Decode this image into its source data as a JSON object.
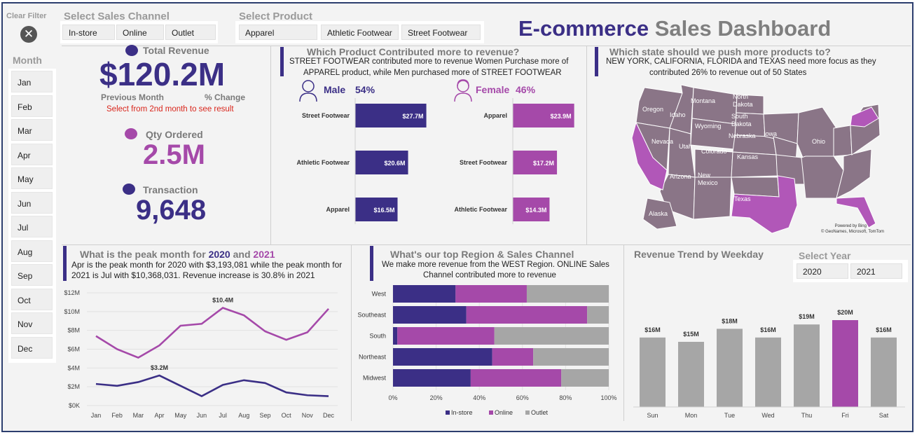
{
  "clear_filter": {
    "label": "Clear Filter"
  },
  "month_slicer": {
    "title": "Month",
    "months": [
      "Jan",
      "Feb",
      "Mar",
      "Apr",
      "May",
      "Jun",
      "Jul",
      "Aug",
      "Sep",
      "Oct",
      "Nov",
      "Dec"
    ]
  },
  "channel_slicer": {
    "title": "Select Sales Channel",
    "options": [
      "In-store",
      "Online",
      "Outlet"
    ]
  },
  "product_slicer": {
    "title": "Select Product",
    "options": [
      "Apparel",
      "Athletic Footwear",
      "Street Footwear"
    ]
  },
  "dashboard_title": {
    "part1": "E-commerce",
    "part2": "Sales Dashboard"
  },
  "kpis": {
    "revenue_label": "Total Revenue",
    "revenue_value": "$120.2M",
    "prev_month_label": "Previous Month",
    "pct_change_label": "% Change",
    "note": "Select from 2nd month to see result",
    "qty_label": "Qty Ordered",
    "qty_value": "2.5M",
    "txn_label": "Transaction",
    "txn_value": "9,648"
  },
  "product_panel": {
    "title": "Which Product Contributed more to revenue?",
    "desc1": "STREET FOOTWEAR contributed more to revenue  Women Purchase more of",
    "desc2": "APPAREL product, while Men purchased more of STREET FOOTWEAR",
    "male_label": "Male",
    "male_pct": "54%",
    "female_label": "Female",
    "female_pct": "46%"
  },
  "state_panel": {
    "title": "Which state should we push more products to?",
    "desc1": "NEW YORK, CALIFORNIA, FLORIDA and TEXAS need more focus as they",
    "desc2": "contributed 26% to revenue out of 50 States",
    "states": [
      "Oregon",
      "Idaho",
      "Montana",
      "North Dakota",
      "South Dakota",
      "Wyoming",
      "Nebraska",
      "Iowa",
      "Nevada",
      "Utah",
      "Colorado",
      "Kansas",
      "Ohio",
      "Arizona",
      "New Mexico",
      "Texas",
      "Alaska"
    ],
    "credit1": "Powered by Bing",
    "credit2": "© GeoNames, Microsoft, TomTom"
  },
  "peak_panel": {
    "title_pre": "What is the peak month for ",
    "y2020": "2020",
    "title_and": " and ",
    "y2021": "2021",
    "desc1": "Apr  is the peak month for 2020 with $3,193,081 while the peak month for",
    "desc2": "2021 is Jul with $10,368,031. Revenue increase is 30.8% in 2021"
  },
  "region_panel": {
    "title": "What's our top Region & Sales Channel",
    "desc1": "We make more revenue from the WEST Region. ONLINE Sales",
    "desc2": "Channel contributed more to revenue"
  },
  "weekday_panel": {
    "title": "Revenue Trend by Weekday"
  },
  "year_slicer": {
    "title": "Select Year",
    "options": [
      "2020",
      "2021"
    ]
  },
  "colors": {
    "navy": "#3b2f86",
    "purple": "#a549a9",
    "gray": "#a6a6a6",
    "title_navy": "#3b2f86",
    "title_gray": "#7f7f7f",
    "red": "#d9261c",
    "focus_state": "#b157b8",
    "map_state": "#8a7587"
  },
  "chart_data": [
    {
      "type": "bar",
      "name": "male_products",
      "categories": [
        "Street Footwear",
        "Athletic Footwear",
        "Apparel"
      ],
      "values": [
        27.7,
        20.6,
        16.5
      ],
      "labels": [
        "$27.7M",
        "$20.6M",
        "$16.5M"
      ],
      "color": "#3b2f86"
    },
    {
      "type": "bar",
      "name": "female_products",
      "categories": [
        "Apparel",
        "Street Footwear",
        "Athletic Footwear"
      ],
      "values": [
        23.9,
        17.2,
        14.3
      ],
      "labels": [
        "$23.9M",
        "$17.2M",
        "$14.3M"
      ],
      "color": "#a549a9"
    },
    {
      "type": "line",
      "name": "monthly_revenue",
      "x": [
        "Jan",
        "Feb",
        "Mar",
        "Apr",
        "May",
        "Jun",
        "Jul",
        "Aug",
        "Sep",
        "Oct",
        "Nov",
        "Dec"
      ],
      "yticks": [
        "$0K",
        "$2M",
        "$4M",
        "$6M",
        "$8M",
        "$10M",
        "$12M"
      ],
      "ylim": [
        0,
        12
      ],
      "series": [
        {
          "name": "2021",
          "color": "#a549a9",
          "values": [
            7.4,
            6.0,
            5.1,
            6.4,
            8.5,
            8.7,
            10.4,
            9.6,
            7.9,
            7.0,
            7.8,
            10.3
          ]
        },
        {
          "name": "2020",
          "color": "#3b2f86",
          "values": [
            2.3,
            2.1,
            2.5,
            3.2,
            2.1,
            1.0,
            2.2,
            2.7,
            2.4,
            1.4,
            1.1,
            1.0
          ]
        }
      ],
      "annotations": [
        {
          "label": "$10.4M",
          "x": "Jul",
          "y": 10.4
        },
        {
          "label": "$3.2M",
          "x": "Apr",
          "y": 3.2
        }
      ]
    },
    {
      "type": "bar",
      "name": "region_channel",
      "stacked": true,
      "percent": true,
      "categories": [
        "West",
        "Southeast",
        "South",
        "Northeast",
        "Midwest"
      ],
      "xticks": [
        "0%",
        "20%",
        "40%",
        "60%",
        "80%",
        "100%"
      ],
      "series": [
        {
          "name": "In-store",
          "color": "#3b2f86",
          "values": [
            29,
            34,
            2,
            46,
            36
          ]
        },
        {
          "name": "Online",
          "color": "#a549a9",
          "values": [
            33,
            56,
            45,
            19,
            42
          ]
        },
        {
          "name": "Outlet",
          "color": "#a6a6a6",
          "values": [
            38,
            10,
            53,
            35,
            22
          ]
        }
      ]
    },
    {
      "type": "bar",
      "name": "weekday_revenue",
      "categories": [
        "Sun",
        "Mon",
        "Tue",
        "Wed",
        "Thu",
        "Fri",
        "Sat"
      ],
      "values": [
        16,
        15,
        18,
        16,
        19,
        20,
        16
      ],
      "labels": [
        "$16M",
        "$15M",
        "$18M",
        "$16M",
        "$19M",
        "$20M",
        "$16M"
      ],
      "highlight": "Fri",
      "color": "#a6a6a6",
      "highlight_color": "#a549a9"
    }
  ]
}
